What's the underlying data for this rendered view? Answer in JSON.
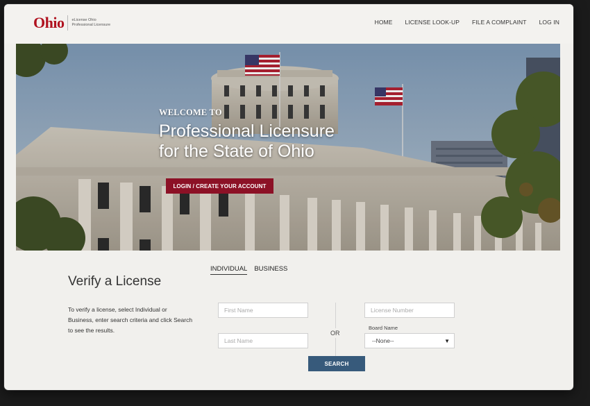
{
  "header": {
    "logo_word": "Ohio",
    "logo_sub_line1": "eLicense Ohio",
    "logo_sub_line2": "Professional Licensure",
    "nav": [
      "HOME",
      "LICENSE LOOK-UP",
      "FILE A COMPLAINT",
      "LOG IN"
    ]
  },
  "hero": {
    "welcome": "WELCOME TO",
    "title_line1": "Professional Licensure",
    "title_line2": "for the State of Ohio",
    "cta_label": "LOGIN / CREATE YOUR ACCOUNT"
  },
  "verify": {
    "tabs": [
      "INDIVIDUAL",
      "BUSINESS"
    ],
    "active_tab": "INDIVIDUAL",
    "title": "Verify a License",
    "description": "To verify a license, select Individual or Business, enter search criteria and click Search to see the results.",
    "first_name_placeholder": "First Name",
    "last_name_placeholder": "Last Name",
    "license_number_placeholder": "License Number",
    "or_label": "OR",
    "board_label": "Board Name",
    "board_selected": "--None--",
    "search_label": "SEARCH"
  },
  "colors": {
    "brand_red": "#b0121f",
    "cta_red": "#8c1126",
    "search_blue": "#375a7b"
  }
}
